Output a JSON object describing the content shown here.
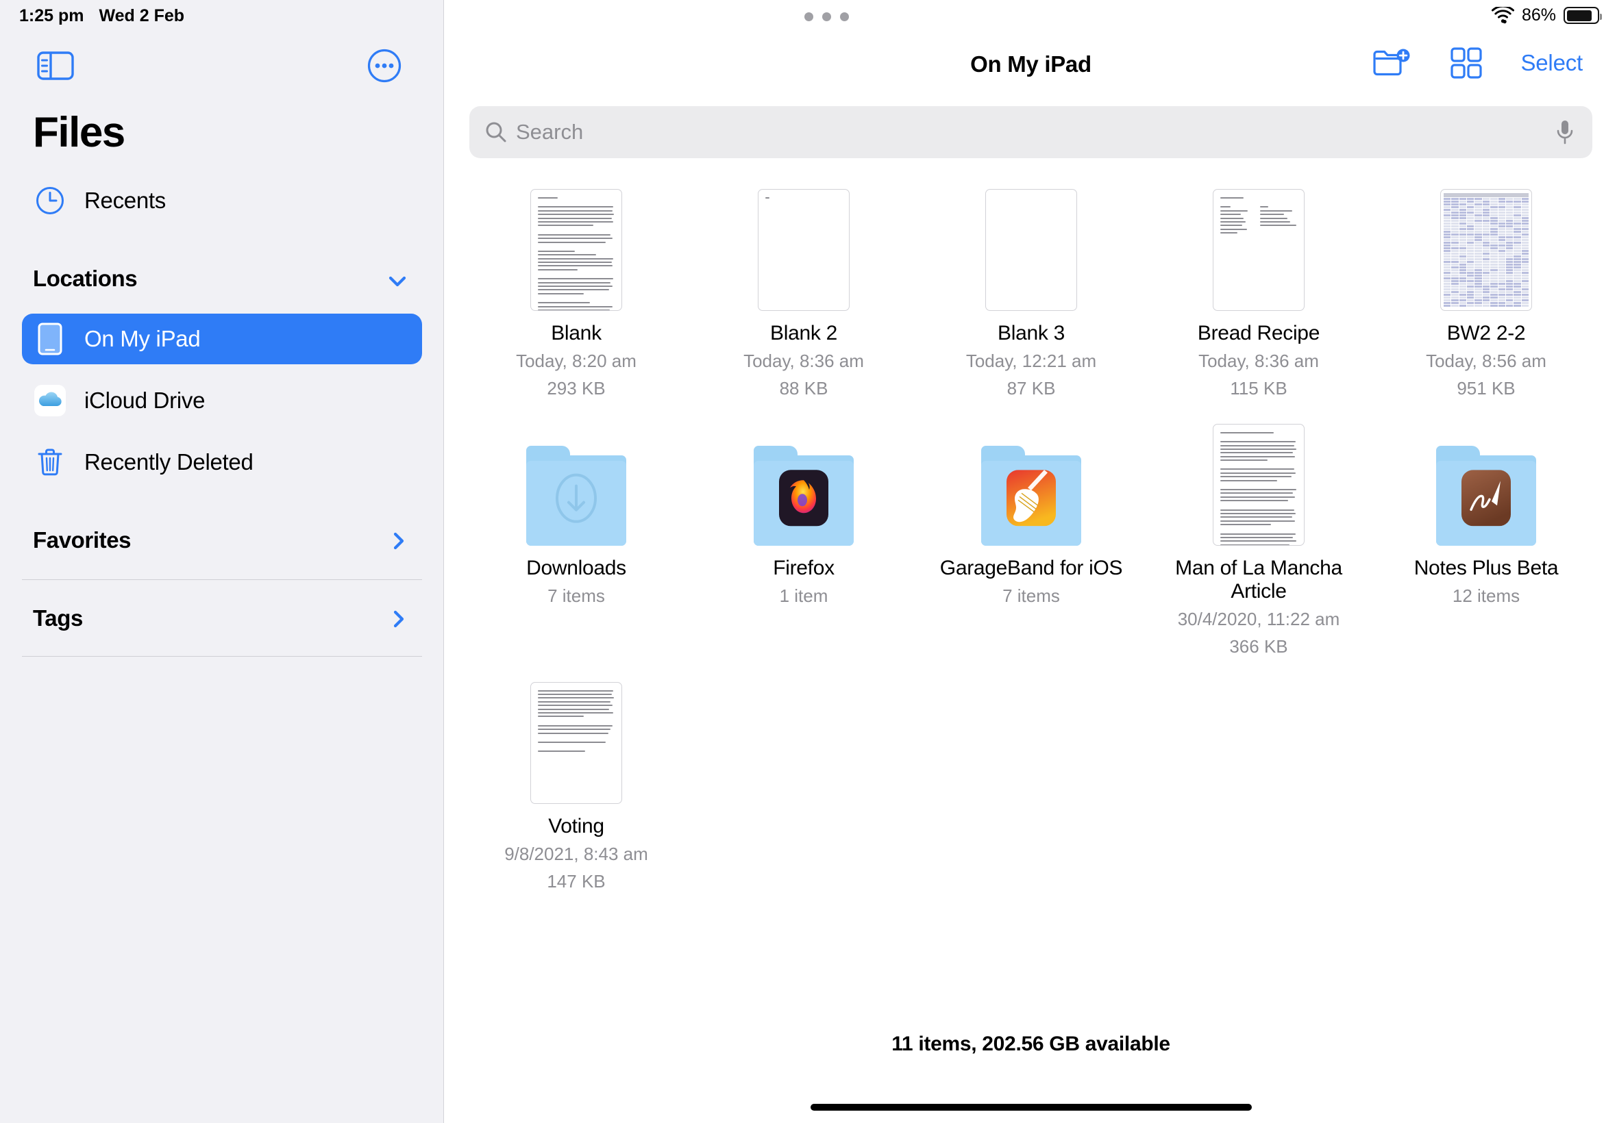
{
  "status_bar": {
    "time": "1:25 pm",
    "date": "Wed 2 Feb",
    "wifi_icon": "wifi-icon",
    "battery_percent": "86%",
    "battery_icon": "battery-icon",
    "multitask_handle_icon": "multitask-dots-icon"
  },
  "sidebar": {
    "toggle_icon": "sidebar-toggle-icon",
    "more_icon": "more-circle-icon",
    "app_title": "Files",
    "recents": {
      "label": "Recents",
      "icon": "clock-icon"
    },
    "locations": {
      "header": "Locations",
      "chevron_icon": "chevron-down-icon",
      "items": [
        {
          "label": "On My iPad",
          "icon": "ipad-icon",
          "selected": true
        },
        {
          "label": "iCloud Drive",
          "icon": "icloud-icon",
          "selected": false
        },
        {
          "label": "Recently Deleted",
          "icon": "trash-icon",
          "selected": false
        }
      ]
    },
    "favorites": {
      "header": "Favorites",
      "chevron_icon": "chevron-right-icon"
    },
    "tags": {
      "header": "Tags",
      "chevron_icon": "chevron-right-icon"
    }
  },
  "detail": {
    "title": "On My iPad",
    "actions": {
      "new_folder_icon": "new-folder-icon",
      "grid_view_icon": "grid-view-icon",
      "select_label": "Select"
    },
    "search": {
      "placeholder": "Search",
      "value": "",
      "search_icon": "search-icon",
      "mic_icon": "microphone-icon"
    },
    "items": [
      {
        "name": "Blank",
        "meta1": "Today, 8:20 am",
        "meta2": "293 KB",
        "kind": "doc-text"
      },
      {
        "name": "Blank 2",
        "meta1": "Today, 8:36 am",
        "meta2": "88 KB",
        "kind": "doc-near-empty"
      },
      {
        "name": "Blank 3",
        "meta1": "Today, 12:21 am",
        "meta2": "87 KB",
        "kind": "doc-empty"
      },
      {
        "name": "Bread Recipe",
        "meta1": "Today, 8:36 am",
        "meta2": "115 KB",
        "kind": "doc-short"
      },
      {
        "name": "BW2 2-2",
        "meta1": "Today, 8:56 am",
        "meta2": "951 KB",
        "kind": "doc-spreadsheet"
      },
      {
        "name": "Downloads",
        "meta1": "7 items",
        "meta2": "",
        "kind": "folder-downloads"
      },
      {
        "name": "Firefox",
        "meta1": "1 item",
        "meta2": "",
        "kind": "folder-firefox"
      },
      {
        "name": "GarageBand for iOS",
        "meta1": "7 items",
        "meta2": "",
        "kind": "folder-garageband"
      },
      {
        "name": "Man of La Mancha Article",
        "meta1": "30/4/2020, 11:22 am",
        "meta2": "366 KB",
        "kind": "doc-article"
      },
      {
        "name": "Notes Plus Beta",
        "meta1": "12 items",
        "meta2": "",
        "kind": "folder-notesplus"
      },
      {
        "name": "Voting",
        "meta1": "9/8/2021, 8:43 am",
        "meta2": "147 KB",
        "kind": "doc-voting"
      }
    ],
    "footer_status": "11 items, 202.56 GB available"
  },
  "colors": {
    "accent_blue": "#2f7cf6",
    "sidebar_bg": "#f1f1f5",
    "folder_blue": "#a8d8f8",
    "secondary_text": "#8e8e93"
  }
}
